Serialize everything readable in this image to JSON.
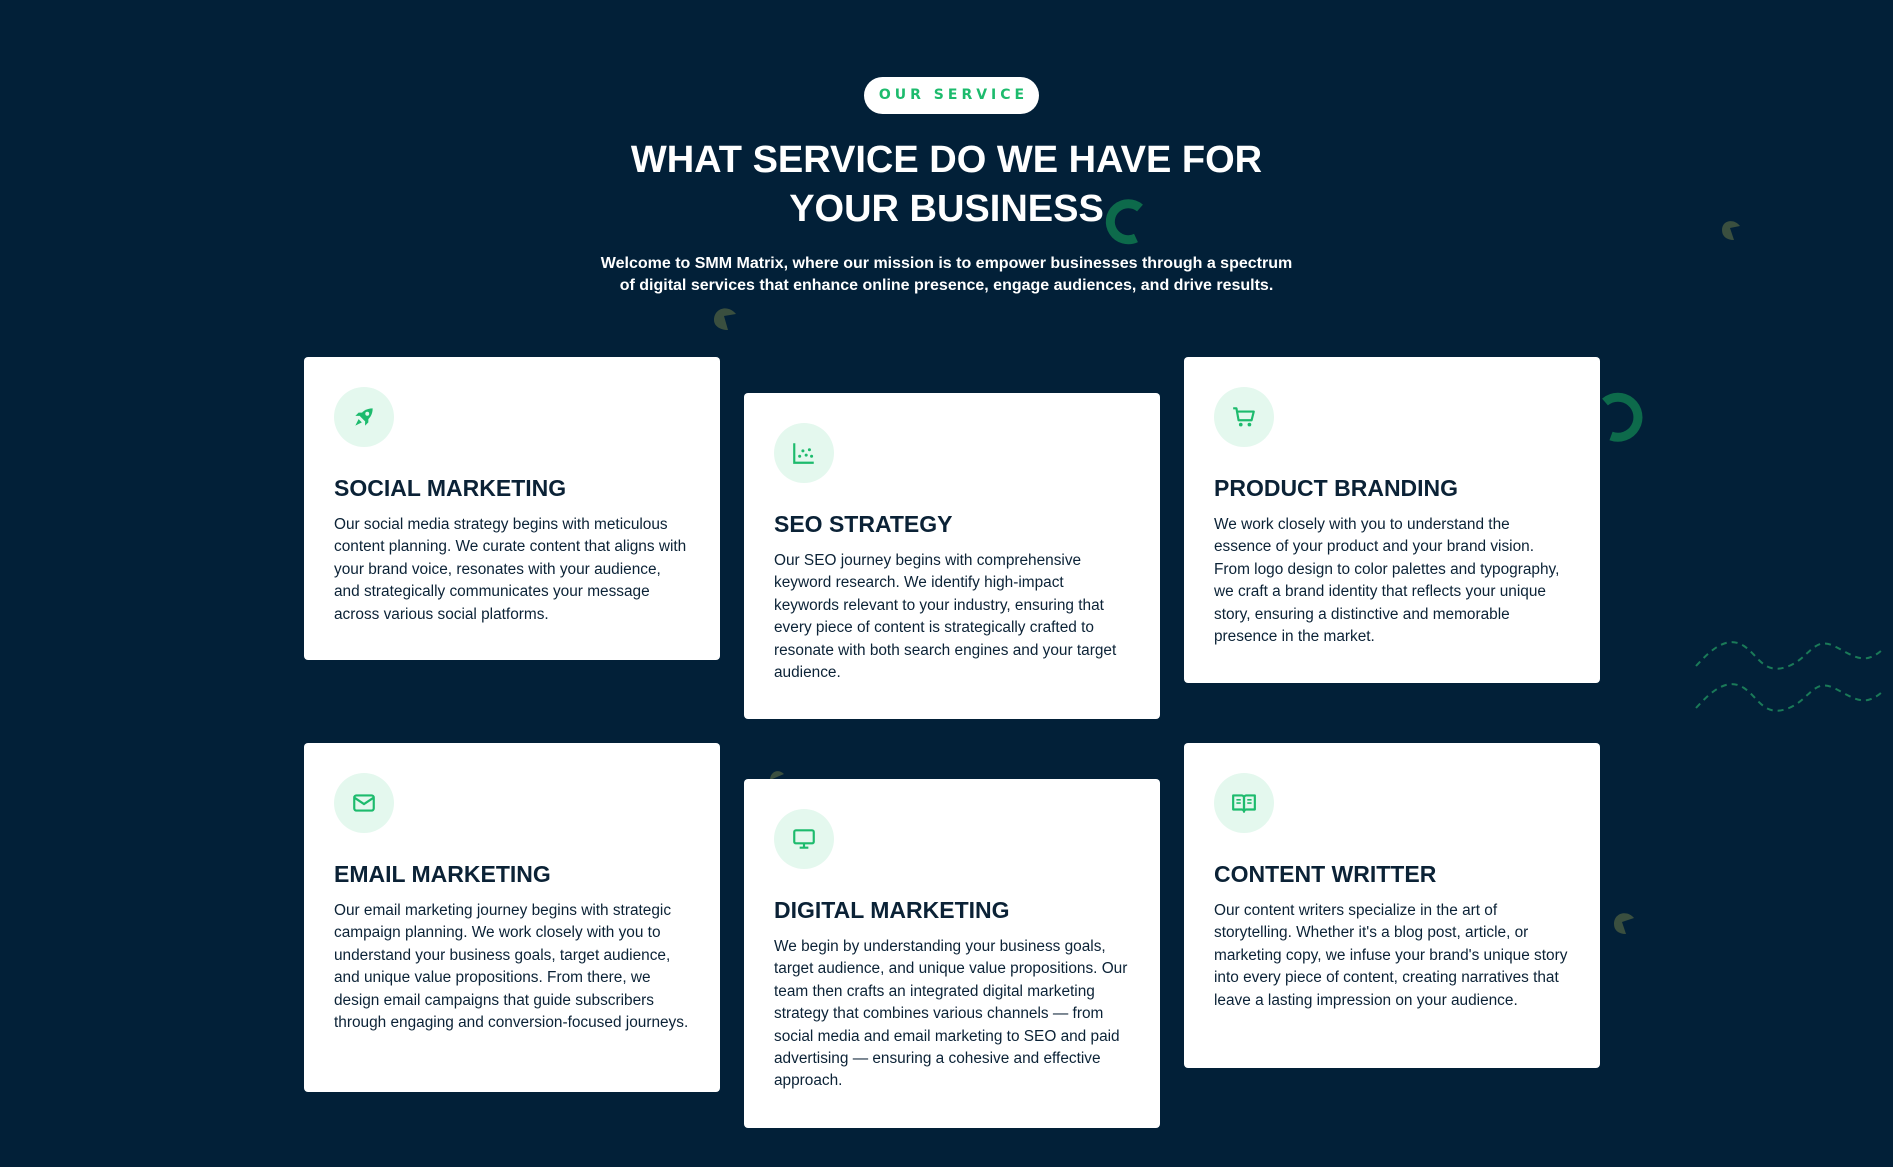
{
  "header": {
    "badge": "OUR SERVICE",
    "title": "WHAT SERVICE DO WE HAVE FOR YOUR BUSINESS",
    "subtitle": "Welcome to SMM Matrix, where our mission is to empower businesses through a spectrum of digital services that enhance online presence, engage audiences, and drive results."
  },
  "colors": {
    "background": "#022038",
    "accent": "#1dbb6d",
    "icon_bg": "#e4f8ee",
    "card_bg": "#ffffff",
    "text_dark": "#0b2236"
  },
  "services": [
    {
      "icon": "rocket-icon",
      "title": "SOCIAL MARKETING",
      "text": "Our social media strategy begins with meticulous content planning. We curate content that aligns with your brand voice, resonates with your audience, and strategically communicates your message across various social platforms."
    },
    {
      "icon": "scatter-chart-icon",
      "title": "SEO STRATEGY",
      "text": "Our SEO journey begins with comprehensive keyword research. We identify high-impact keywords relevant to your industry, ensuring that every piece of content is strategically crafted to resonate with both search engines and your target audience."
    },
    {
      "icon": "shopping-cart-icon",
      "title": "PRODUCT BRANDING",
      "text": "We work closely with you to understand the essence of your product and your brand vision. From logo design to color palettes and typography, we craft a brand identity that reflects your unique story, ensuring a distinctive and memorable presence in the market."
    },
    {
      "icon": "envelope-icon",
      "title": "EMAIL MARKETING",
      "text": "Our email marketing journey begins with strategic campaign planning. We work closely with you to understand your business goals, target audience, and unique value propositions. From there, we design email campaigns that guide subscribers through engaging and conversion-focused journeys."
    },
    {
      "icon": "monitor-icon",
      "title": "DIGITAL MARKETING",
      "text": "We begin by understanding your business goals, target audience, and unique value propositions. Our team then crafts an integrated digital marketing strategy that combines various channels — from social media and email marketing to SEO and paid advertising — ensuring a cohesive and effective approach."
    },
    {
      "icon": "open-book-icon",
      "title": "CONTENT WRITTER",
      "text": "Our content writers specialize in the art of storytelling. Whether it's a blog post, article, or marketing copy, we infuse your brand's unique story into every piece of content, creating narratives that leave a lasting impression on your audience."
    }
  ]
}
